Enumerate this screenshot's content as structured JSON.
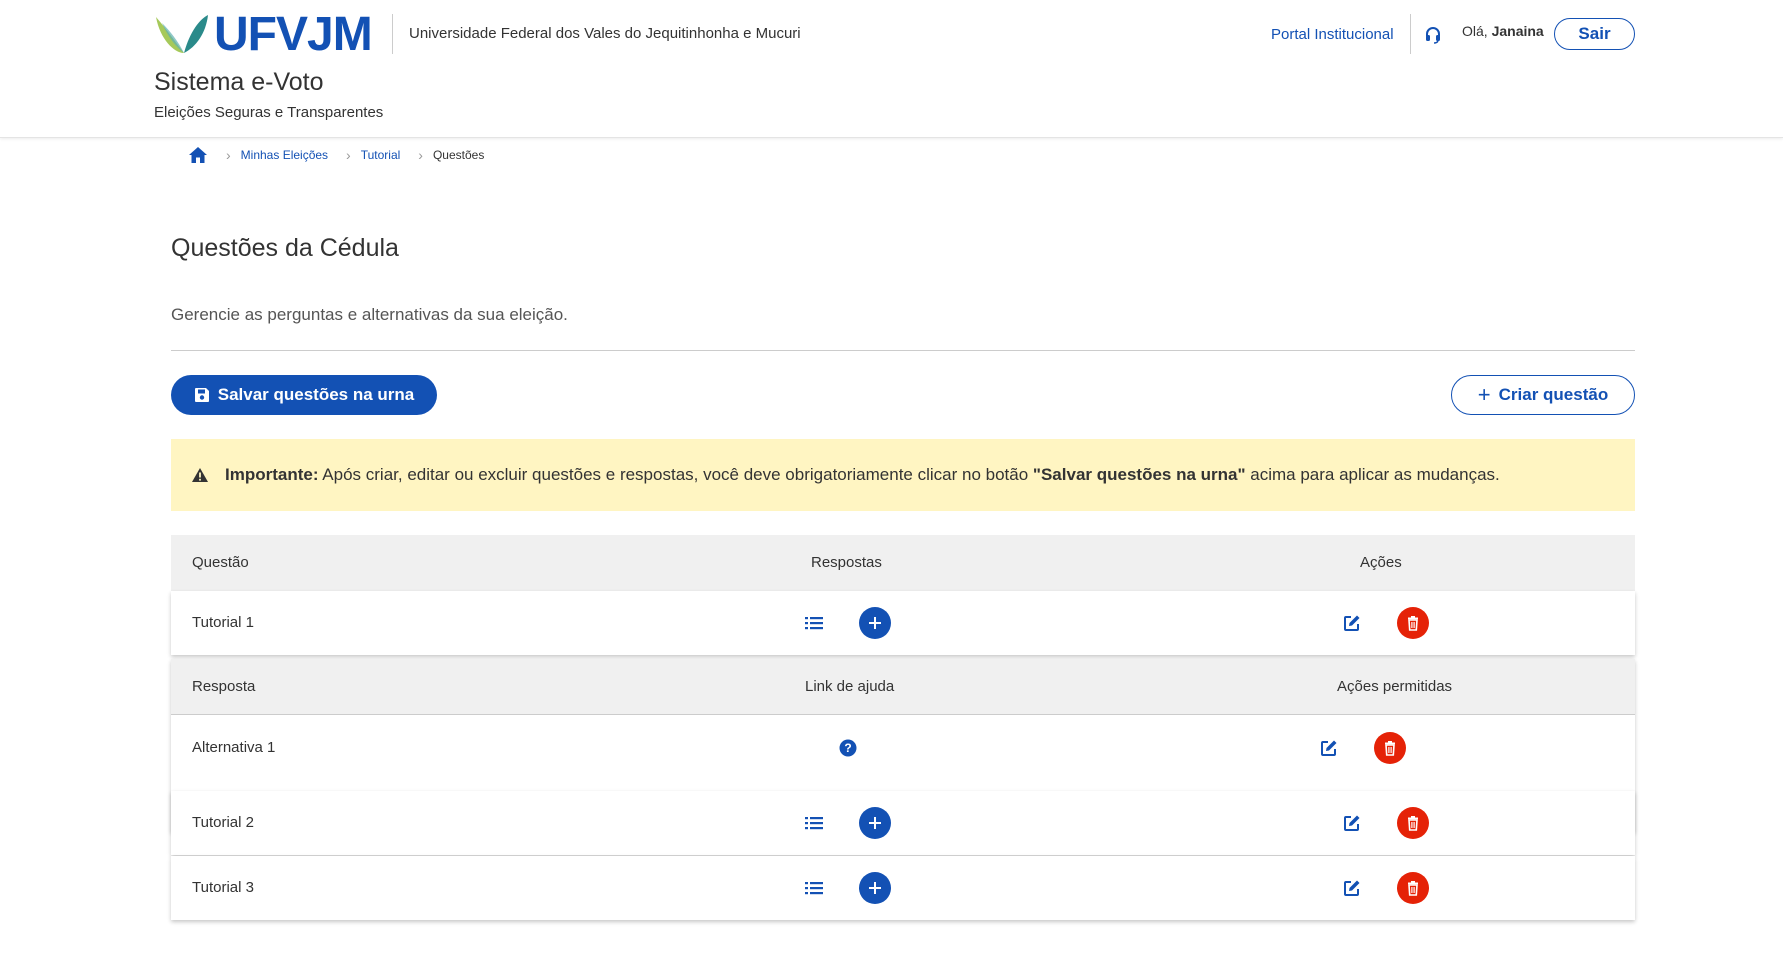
{
  "header": {
    "logo_text": "UFVJM",
    "university_name": "Universidade Federal dos Vales do Jequitinhonha e Mucuri",
    "system_title": "Sistema e-Voto",
    "system_subtitle": "Eleições Seguras e Transparentes",
    "portal_link": "Portal Institucional",
    "greeting_prefix": "Olá,",
    "user_name": "Janaina",
    "logout_label": "Sair"
  },
  "breadcrumb": {
    "home_icon": "home-icon",
    "items": [
      "Minhas Eleições",
      "Tutorial"
    ],
    "current": "Questões"
  },
  "page": {
    "title": "Questões da Cédula",
    "description": "Gerencie as perguntas e alternativas da sua eleição.",
    "save_button": "Salvar questões na urna",
    "create_button": "Criar questão"
  },
  "alert": {
    "label": "Importante:",
    "text_before": " Após criar, editar ou excluir questões e respostas, você deve obrigatoriamente clicar no botão ",
    "button_ref": "\"Salvar questões na urna\"",
    "text_after": " acima para aplicar as mudanças."
  },
  "table": {
    "headers": {
      "question": "Questão",
      "answers": "Respostas",
      "actions": "Ações"
    },
    "questions": [
      {
        "name": "Tutorial 1"
      },
      {
        "name": "Tutorial 2"
      },
      {
        "name": "Tutorial 3"
      }
    ],
    "sub_table": {
      "headers": {
        "answer": "Resposta",
        "help_link": "Link de ajuda",
        "allowed_actions": "Ações permitidas"
      },
      "rows": [
        {
          "answer": "Alternativa 1"
        }
      ]
    }
  },
  "colors": {
    "primary": "#1351b4",
    "danger": "#e52207",
    "warning_bg": "#fff5c2",
    "table_header_bg": "#f0f0f0"
  }
}
